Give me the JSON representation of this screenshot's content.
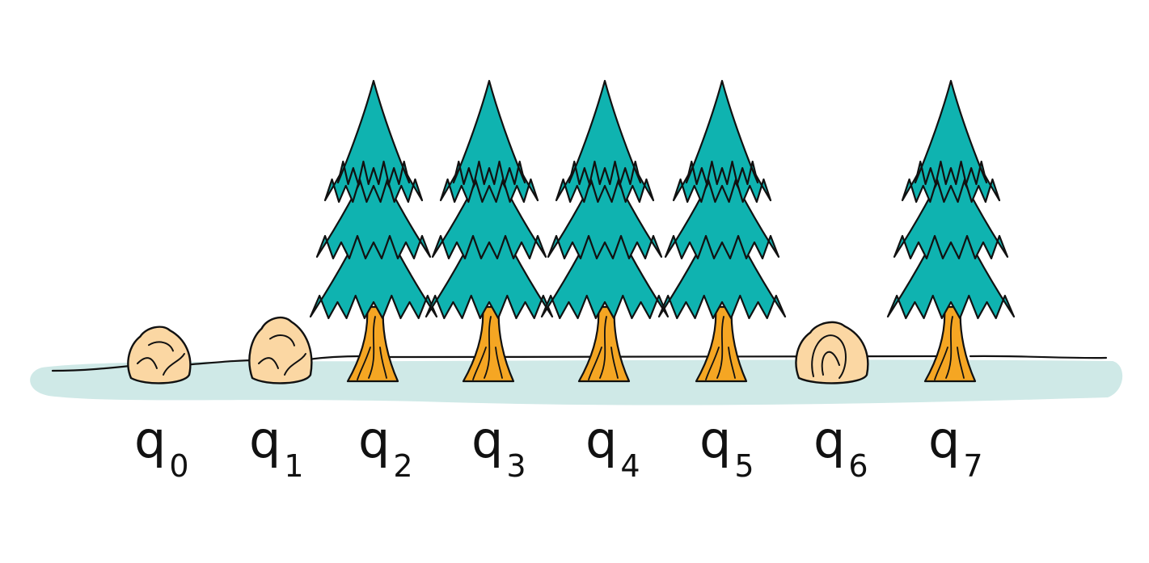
{
  "colors": {
    "ground": "#cfe9e7",
    "outline": "#111111",
    "foliage": "#0fb3b0",
    "trunk": "#f5a623",
    "rock": "#fbd7a3"
  },
  "positions": [
    {
      "symbol": "q",
      "subscript": "0",
      "object": "rock"
    },
    {
      "symbol": "q",
      "subscript": "1",
      "object": "rock"
    },
    {
      "symbol": "q",
      "subscript": "2",
      "object": "tree"
    },
    {
      "symbol": "q",
      "subscript": "3",
      "object": "tree"
    },
    {
      "symbol": "q",
      "subscript": "4",
      "object": "tree"
    },
    {
      "symbol": "q",
      "subscript": "5",
      "object": "tree"
    },
    {
      "symbol": "q",
      "subscript": "6",
      "object": "rock"
    },
    {
      "symbol": "q",
      "subscript": "7",
      "object": "tree"
    }
  ]
}
